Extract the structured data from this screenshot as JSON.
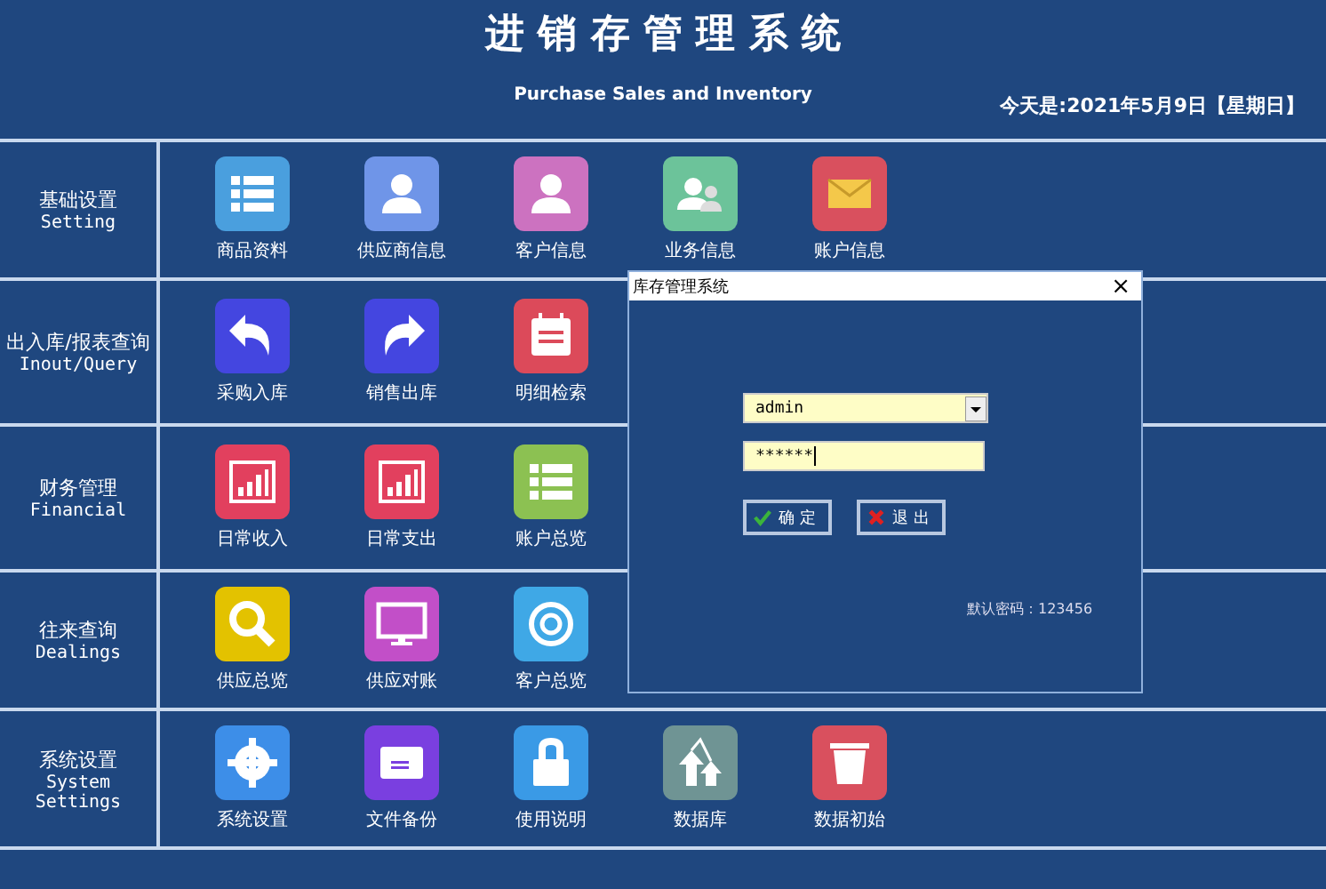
{
  "header": {
    "title": "进 销 存 管 理 系 统",
    "subtitle": "Purchase Sales and Inventory",
    "date": "今天是:2021年5月9日【星期日】"
  },
  "sections": [
    {
      "name": "基础设置",
      "english": [
        "Setting"
      ],
      "items": [
        {
          "color": "#4a9fde",
          "label": "商品资料"
        },
        {
          "color": "#6f95e8",
          "label": "供应商信息"
        },
        {
          "color": "#cc72c0",
          "label": "客户信息"
        },
        {
          "color": "#6cc39a",
          "label": "业务信息"
        },
        {
          "color": "#d9505e",
          "label": "账户信息"
        }
      ]
    },
    {
      "name": "出入库/报表查询",
      "english": [
        "Inout/Query"
      ],
      "items": [
        {
          "color": "#4446e0",
          "label": "采购入库"
        },
        {
          "color": "#4446e0",
          "label": "销售出库"
        },
        {
          "color": "#dc4a5a",
          "label": "明细检索"
        }
      ]
    },
    {
      "name": "财务管理",
      "english": [
        "Financial"
      ],
      "items": [
        {
          "color": "#e2405e",
          "label": "日常收入"
        },
        {
          "color": "#e2405e",
          "label": "日常支出"
        },
        {
          "color": "#8cc152",
          "label": "账户总览"
        }
      ]
    },
    {
      "name": "往来查询",
      "english": [
        "Dealings"
      ],
      "items": [
        {
          "color": "#e3c200",
          "label": "供应总览"
        },
        {
          "color": "#c24fc8",
          "label": "供应对账"
        },
        {
          "color": "#3fa8e6",
          "label": "客户总览"
        }
      ]
    },
    {
      "name": "系统设置",
      "english": [
        "System",
        "Settings"
      ],
      "items": [
        {
          "color": "#3d8ee8",
          "label": "系统设置"
        },
        {
          "color": "#7a3fe0",
          "label": "文件备份"
        },
        {
          "color": "#3a9ae6",
          "label": "使用说明"
        },
        {
          "color": "#6f9494",
          "label": "数据库"
        },
        {
          "color": "#d9505e",
          "label": "数据初始"
        }
      ]
    }
  ],
  "dialog": {
    "title": "库存管理系统",
    "close": "×",
    "user": "admin",
    "password": "******",
    "buttons": [
      {
        "kind": "ok",
        "label": "确 定"
      },
      {
        "kind": "exit",
        "label": "退 出"
      }
    ],
    "hint": "默认密码：123456"
  }
}
